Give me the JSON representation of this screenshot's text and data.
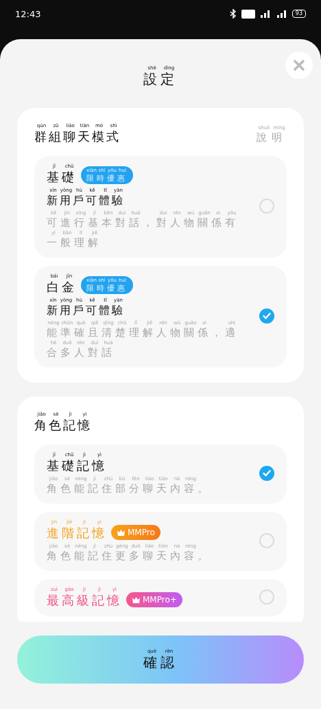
{
  "status_bar": {
    "time": "12:43",
    "battery": "93"
  },
  "title": {
    "text": "設定",
    "pinyin": "shè dìng"
  },
  "group_chat_mode": {
    "heading": {
      "text": "群組聊天模式",
      "pinyin": "qún zǔ liáo tiān mó shì"
    },
    "help": {
      "text": "說明",
      "pinyin": "shuō míng"
    },
    "options": [
      {
        "name": {
          "text": "基礎",
          "pinyin": "jī chǔ"
        },
        "badge": {
          "kind": "promo",
          "text": "限時優惠",
          "pinyin": "xiàn shí yōu huì"
        },
        "subtitle": {
          "text": "新用戶可體驗",
          "pinyin": "xīn yòng hù kě tǐ yàn"
        },
        "description_lines": [
          {
            "text": "可進行基本對話，對人物關係有",
            "pinyin": "kě jìn xíng jī běn duì huà duì rén wù guān xì yǒu"
          },
          {
            "text": "一般理解",
            "pinyin": "yī bān lǐ jiě"
          }
        ],
        "selected": false
      },
      {
        "name": {
          "text": "白金",
          "pinyin": "bái jīn"
        },
        "badge": {
          "kind": "promo",
          "text": "限時優惠",
          "pinyin": "xiàn shí yōu huì"
        },
        "subtitle": {
          "text": "新用戶可體驗",
          "pinyin": "xīn yòng hù kě tǐ yàn"
        },
        "description_lines": [
          {
            "text": "能準確且清楚理解人物關係，適",
            "pinyin": "néng zhǔn què qiě qīng chǔ lǐ jiě rén wù guān xì shì"
          },
          {
            "text": "合多人對話",
            "pinyin": "hé duō rén duì huà"
          }
        ],
        "selected": true
      }
    ]
  },
  "character_memory": {
    "heading": {
      "text": "角色記憶",
      "pinyin": "jiǎo sè jì yì"
    },
    "options": [
      {
        "name": {
          "text": "基礎記憶",
          "pinyin": "jī chǔ jì yì"
        },
        "color": "#111111",
        "description_lines": [
          {
            "text": "角色能記住部分聊天內容。",
            "pinyin": "jiǎo sè néng jì zhù bù fēn liáo tiān nà róng"
          }
        ],
        "selected": true
      },
      {
        "name": {
          "text": "進階記憶",
          "pinyin": "jìn jiē jì yì"
        },
        "color": "#f5a020",
        "badge": {
          "kind": "mmpro",
          "text": "MMPro"
        },
        "description_lines": [
          {
            "text": "角色能記住更多聊天內容。",
            "pinyin": "jiǎo sè néng jì zhù gèng duō liáo tiān nà róng"
          }
        ],
        "selected": false
      },
      {
        "name": {
          "text": "最高級記憶",
          "pinyin": "zuì gāo jí jì yì"
        },
        "color": "#f0508c",
        "badge": {
          "kind": "mmpro_plus",
          "text": "MMPro+"
        },
        "selected": false
      }
    ]
  },
  "confirm_button": {
    "text": "確認",
    "pinyin": "què rèn"
  }
}
